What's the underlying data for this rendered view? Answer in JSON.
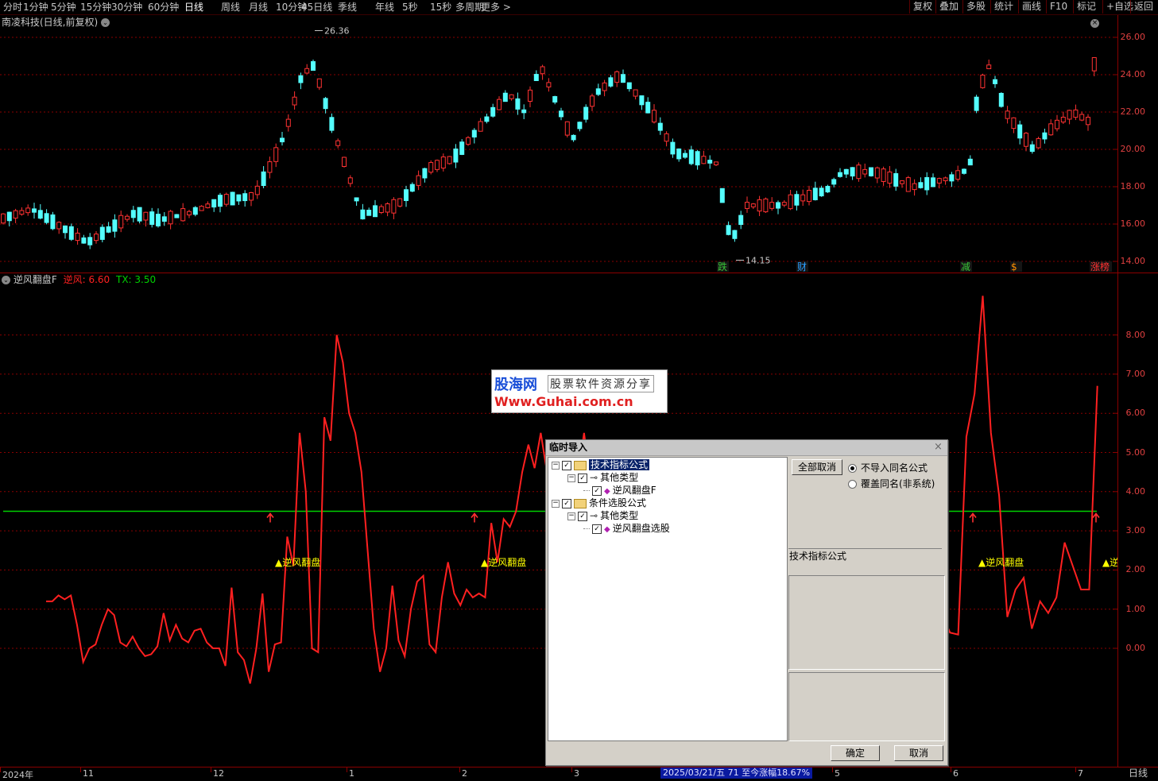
{
  "toolbar": {
    "periods": [
      "分时",
      "1分钟",
      "5分钟",
      "15分钟",
      "30分钟",
      "60分钟",
      "日线",
      "周线",
      "月线",
      "10分钟",
      "45日线",
      "季线",
      "年线",
      "5秒",
      "15秒",
      "多周期",
      "更多 >"
    ],
    "active_period": "日线",
    "right_buttons": [
      "复权",
      "叠加",
      "多股",
      "统计",
      "画线",
      "F10",
      "标记",
      "+自选",
      "返回"
    ]
  },
  "main_chart": {
    "title": "南凌科技(日线,前复权)",
    "y_ticks": [
      "26.00",
      "24.00",
      "22.00",
      "20.00",
      "18.00",
      "16.00",
      "14.00"
    ],
    "high_label": "26.36",
    "low_label": "14.15",
    "event_markers": [
      {
        "text": "跌",
        "color": "#38c838"
      },
      {
        "text": "财",
        "color": "#2aa0ff"
      },
      {
        "text": "减",
        "color": "#38c838"
      },
      {
        "text": "$",
        "color": "#ff9000"
      },
      {
        "text": "涨榜",
        "color": "#ff3030"
      }
    ]
  },
  "indicator": {
    "name": "逆风翻盘F",
    "line1_label": "逆风:",
    "line1_value": "6.60",
    "line2_label": "TX:",
    "line2_value": "3.50",
    "y_ticks": [
      "8.00",
      "7.00",
      "6.00",
      "5.00",
      "4.00",
      "3.00",
      "2.00",
      "1.00",
      "0.00"
    ],
    "signal_text": "▲逆风翻盘",
    "signal_text_cut": "▲逆",
    "threshold": 3.5,
    "series": [
      [
        1.2,
        4
      ],
      [
        1.2,
        5
      ],
      [
        1.35,
        6
      ],
      [
        1.25,
        7
      ],
      [
        1.35,
        8
      ],
      [
        0.6,
        9
      ],
      [
        -0.35,
        10
      ],
      [
        0.0,
        11
      ],
      [
        0.1,
        12
      ],
      [
        0.6,
        13
      ],
      [
        1.0,
        14
      ],
      [
        0.85,
        15
      ],
      [
        0.15,
        16
      ],
      [
        0.05,
        17
      ],
      [
        0.3,
        18
      ],
      [
        0.0,
        19
      ],
      [
        -0.2,
        20
      ],
      [
        -0.15,
        21
      ],
      [
        0.05,
        22
      ],
      [
        0.9,
        23
      ],
      [
        0.2,
        24
      ],
      [
        0.6,
        25
      ],
      [
        0.25,
        26
      ],
      [
        0.15,
        27
      ],
      [
        0.45,
        28
      ],
      [
        0.5,
        29
      ],
      [
        0.15,
        30
      ],
      [
        0.0,
        31
      ],
      [
        0.0,
        32
      ],
      [
        -0.45,
        33
      ],
      [
        1.55,
        34
      ],
      [
        -0.1,
        35
      ],
      [
        -0.3,
        36
      ],
      [
        -0.9,
        37
      ],
      [
        0.0,
        38
      ],
      [
        1.4,
        39
      ],
      [
        -0.6,
        40
      ],
      [
        0.1,
        41
      ],
      [
        0.15,
        42
      ],
      [
        2.85,
        43
      ],
      [
        2.1,
        44
      ],
      [
        5.5,
        45
      ],
      [
        4.0,
        46
      ],
      [
        0.0,
        47
      ],
      [
        -0.1,
        48
      ],
      [
        5.9,
        49
      ],
      [
        5.3,
        50
      ],
      [
        8.0,
        51
      ],
      [
        7.3,
        52
      ],
      [
        6.0,
        53
      ],
      [
        5.5,
        54
      ],
      [
        4.5,
        55
      ],
      [
        2.5,
        56
      ],
      [
        0.5,
        57
      ],
      [
        -0.6,
        58
      ],
      [
        0.0,
        59
      ],
      [
        1.6,
        60
      ],
      [
        0.2,
        61
      ],
      [
        -0.2,
        62
      ],
      [
        1.0,
        63
      ],
      [
        1.7,
        64
      ],
      [
        1.85,
        65
      ],
      [
        0.1,
        66
      ],
      [
        -0.1,
        67
      ],
      [
        1.3,
        68
      ],
      [
        2.2,
        69
      ],
      [
        1.4,
        70
      ],
      [
        1.1,
        71
      ],
      [
        1.5,
        72
      ],
      [
        1.3,
        73
      ],
      [
        1.4,
        74
      ],
      [
        1.3,
        75
      ],
      [
        3.2,
        76
      ],
      [
        2.2,
        77
      ],
      [
        3.3,
        78
      ],
      [
        3.1,
        79
      ],
      [
        3.5,
        80
      ],
      [
        4.5,
        81
      ],
      [
        5.2,
        82
      ],
      [
        4.6,
        83
      ],
      [
        5.5,
        84
      ],
      [
        4.5,
        85
      ],
      [
        4.8,
        86
      ],
      [
        4.2,
        87
      ],
      [
        1.5,
        88
      ],
      [
        1.7,
        89
      ],
      [
        4.4,
        90
      ],
      [
        5.5,
        91
      ],
      [
        4.3,
        92
      ]
    ],
    "series_right": [
      [
        0.9,
        0
      ],
      [
        0.4,
        1
      ],
      [
        0.35,
        2
      ],
      [
        5.4,
        3
      ],
      [
        6.5,
        4
      ],
      [
        9.0,
        5
      ],
      [
        5.5,
        6
      ],
      [
        3.9,
        7
      ],
      [
        0.8,
        8
      ],
      [
        1.5,
        9
      ],
      [
        1.8,
        10
      ],
      [
        0.5,
        11
      ],
      [
        1.2,
        12
      ],
      [
        0.9,
        13
      ],
      [
        1.3,
        14
      ],
      [
        2.7,
        15
      ],
      [
        2.1,
        16
      ],
      [
        1.5,
        17
      ],
      [
        1.5,
        18
      ],
      [
        6.7,
        19
      ]
    ]
  },
  "bottom_bar": {
    "dates": [
      "2024年",
      "11",
      "12",
      "1",
      "2",
      "3",
      "5",
      "6",
      "7"
    ],
    "status": "2025/03/21/五  71  至今涨幅18.67%",
    "period": "日线"
  },
  "dialog": {
    "title": "临时导入",
    "tree": [
      {
        "label": "技术指标公式",
        "level": 0,
        "selected": true,
        "kind": "folder"
      },
      {
        "label": "其他类型",
        "level": 1,
        "kind": "key"
      },
      {
        "label": "逆风翻盘F",
        "level": 2,
        "kind": "item"
      },
      {
        "label": "条件选股公式",
        "level": 0,
        "kind": "folder"
      },
      {
        "label": "其他类型",
        "level": 1,
        "kind": "key"
      },
      {
        "label": "逆风翻盘选股",
        "level": 2,
        "kind": "item"
      }
    ],
    "deselect_all": "全部取消",
    "radio_skip": "不导入同名公式",
    "radio_overwrite": "覆盖同名(非系统)",
    "type_label": "技术指标公式",
    "ok": "确定",
    "cancel": "取消"
  },
  "watermark": {
    "logo": "股海网",
    "slogan": "股票软件资源分享",
    "url": "Www.Guhai.com.cn"
  },
  "colors": {
    "up": "#ff3232",
    "down": "#54ffff",
    "grid": "#8a0000",
    "indicator_line": "#ff2020",
    "threshold_line": "#00d000",
    "signal_text": "#ffff00"
  }
}
